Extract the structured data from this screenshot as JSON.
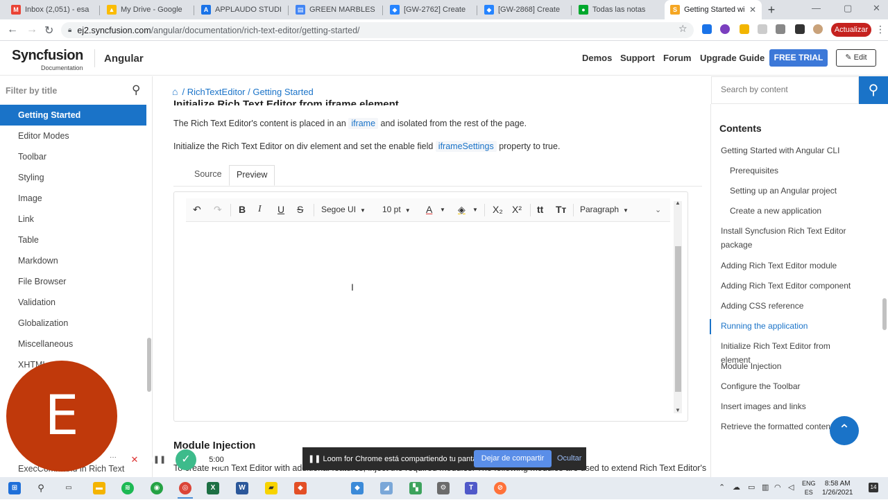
{
  "browser": {
    "tabs": [
      {
        "title": "Inbox (2,051) - esa",
        "color": "#ea4335",
        "glyph": "M"
      },
      {
        "title": "My Drive - Google",
        "color": "#fbbc04",
        "glyph": "▲"
      },
      {
        "title": "APPLAUDO STUDIO",
        "color": "#1a73e8",
        "glyph": "A"
      },
      {
        "title": "GREEN MARBLES",
        "color": "#4285f4",
        "glyph": "▤"
      },
      {
        "title": "[GW-2762] Create",
        "color": "#2684ff",
        "glyph": "◆"
      },
      {
        "title": "[GW-2868] Create",
        "color": "#2684ff",
        "glyph": "◆"
      },
      {
        "title": "Todas las notas",
        "color": "#00a82d",
        "glyph": "●"
      },
      {
        "title": "Getting Started wi",
        "color": "#f5a623",
        "glyph": "S"
      }
    ],
    "new_tab": "+",
    "url_host": "ej2.syncfusion.com",
    "url_path": "/angular/documentation/rich-text-editor/getting-started/",
    "update_label": "Actualizar"
  },
  "header": {
    "brand": "Syncfusion",
    "brand_sub": "Documentation",
    "framework": "Angular",
    "links": [
      "Demos",
      "Support",
      "Forum",
      "Upgrade Guide"
    ],
    "trial": "FREE TRIAL",
    "edit": "Edit"
  },
  "sidebar": {
    "filter_placeholder": "Filter by title",
    "items": [
      "Getting Started",
      "Editor Modes",
      "Toolbar",
      "Styling",
      "Image",
      "Link",
      "Table",
      "Markdown",
      "File Browser",
      "Validation",
      "Globalization",
      "Miscellaneous",
      "XHTML",
      "ExecCommand in Rich Text Editor"
    ]
  },
  "main": {
    "breadcrumb": "/ RichTextEditor / Getting Started",
    "cut_heading": "Initialize Rich Text Editor from iframe element",
    "p1_a": "The Rich Text Editor's content is placed in an",
    "p1_code": "iframe",
    "p1_b": "and isolated from the rest of the page.",
    "p2_a": "Initialize the Rich Text Editor on div element and set the enable field",
    "p2_code": "iframeSettings",
    "p2_b": "property to true.",
    "tab_source": "Source",
    "tab_preview": "Preview",
    "toolbar": {
      "font_name": "Segoe UI",
      "font_size": "10 pt",
      "format": "Paragraph"
    },
    "module_heading": "Module Injection",
    "module_text": "To create Rich Text Editor with additional features, inject the required modules. The following modules are used to extend Rich Text Editor's"
  },
  "right": {
    "search_placeholder": "Search by content",
    "contents_title": "Contents",
    "toc": [
      {
        "label": "Getting Started with Angular CLI",
        "sub": false
      },
      {
        "label": "Prerequisites",
        "sub": true
      },
      {
        "label": "Setting up an Angular project",
        "sub": true
      },
      {
        "label": "Create a new application",
        "sub": true
      },
      {
        "label": "Install Syncfusion Rich Text Editor package",
        "sub": false
      },
      {
        "label": "Adding Rich Text Editor module",
        "sub": false
      },
      {
        "label": "Adding Rich Text Editor component",
        "sub": false
      },
      {
        "label": "Adding CSS reference",
        "sub": false
      },
      {
        "label": "Running the application",
        "sub": false,
        "active": true
      },
      {
        "label": "Initialize Rich Text Editor from element",
        "sub": false
      },
      {
        "label": "Module Injection",
        "sub": false
      },
      {
        "label": "Configure the Toolbar",
        "sub": false
      },
      {
        "label": "Insert images and links",
        "sub": false
      },
      {
        "label": "Retrieve the formatted content",
        "sub": false
      }
    ]
  },
  "loom": {
    "avatar_letter": "E",
    "timer": "5:00",
    "message": "Loom for Chrome está compartiendo tu pantalla.",
    "stop_label": "Dejar de compartir",
    "hide_label": "Ocultar"
  },
  "taskbar": {
    "lang_top": "ENG",
    "lang_bottom": "ES",
    "time": "8:58 AM",
    "date": "1/26/2021",
    "notifications": "14"
  }
}
